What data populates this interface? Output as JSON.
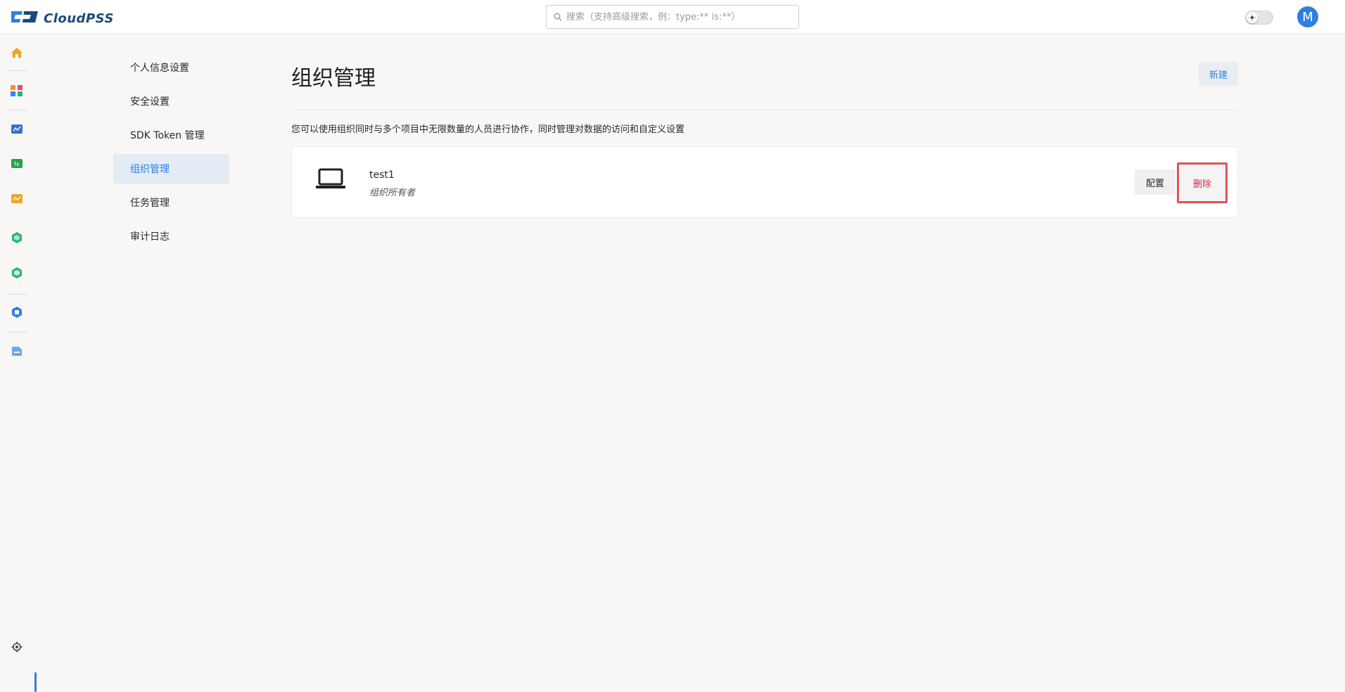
{
  "app": {
    "logo_text": "CloudPSS"
  },
  "header": {
    "search_placeholder": "搜索（支持高级搜索，例：type:** is:**）",
    "avatar_initial": "M",
    "accent_color": "#2f7fe0"
  },
  "rail": {
    "icons": [
      "home-icon",
      "apps-icon",
      "simstudio-icon",
      "function-icon",
      "analytics-icon",
      "module-icon-1",
      "module-icon-2",
      "platform-icon",
      "file-icon",
      "settings-icon"
    ]
  },
  "settings_nav": {
    "items": [
      {
        "label": "个人信息设置"
      },
      {
        "label": "安全设置"
      },
      {
        "label": "SDK Token 管理"
      },
      {
        "label": "组织管理",
        "active": true
      },
      {
        "label": "任务管理"
      },
      {
        "label": "审计日志"
      }
    ]
  },
  "main": {
    "title": "组织管理",
    "new_label": "新建",
    "description": "您可以使用组织同时与多个项目中无限数量的人员进行协作，同时管理对数据的访问和自定义设置",
    "org": {
      "name": "test1",
      "role": "组织所有者",
      "configure_label": "配置",
      "delete_label": "删除"
    }
  }
}
